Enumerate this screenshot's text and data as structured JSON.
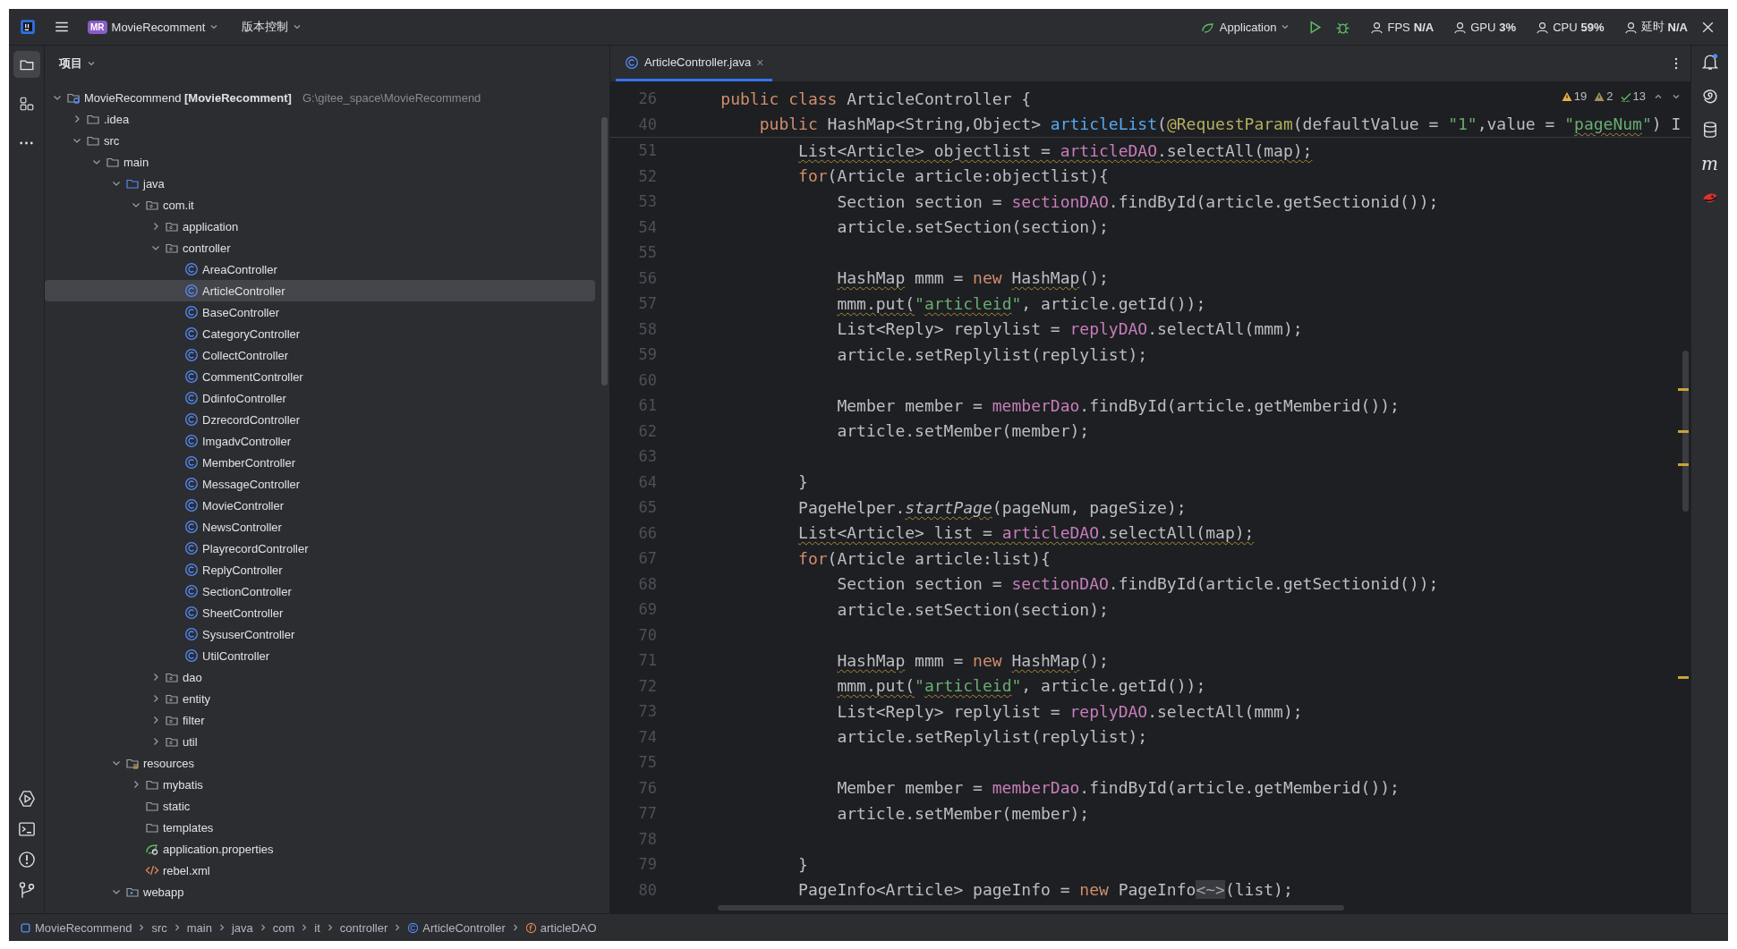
{
  "title_bar": {
    "project_badge": "MR",
    "project": "MovieRecomment",
    "vcs": "版本控制",
    "run_config": "Application",
    "stats": [
      {
        "label": "FPS",
        "value": "N/A"
      },
      {
        "label": "GPU",
        "value": "3%"
      },
      {
        "label": "CPU",
        "value": "59%"
      },
      {
        "label": "延时",
        "value": "N/A"
      }
    ]
  },
  "left_tools": [
    {
      "kind": "project",
      "selected": true
    },
    {
      "kind": "structure",
      "selected": false
    },
    {
      "kind": "more",
      "selected": false
    }
  ],
  "left_tools_bottom": [
    {
      "kind": "run"
    },
    {
      "kind": "terminal"
    },
    {
      "kind": "problems"
    },
    {
      "kind": "git"
    }
  ],
  "project_panel": {
    "title": "项目",
    "tree": [
      {
        "kind": "module",
        "name": "MovieRecommend",
        "module": "[MovieRecomment]",
        "path": "G:\\gitee_space\\MovieRecommend",
        "expanded": true,
        "selected": false,
        "children": [
          {
            "kind": "folder",
            "name": ".idea",
            "expanded": false,
            "selected": false
          },
          {
            "kind": "folder",
            "name": "src",
            "expanded": true,
            "selected": false,
            "children": [
              {
                "kind": "folder",
                "name": "main",
                "expanded": true,
                "selected": false,
                "children": [
                  {
                    "kind": "source",
                    "name": "java",
                    "expanded": true,
                    "selected": false,
                    "children": [
                      {
                        "kind": "package",
                        "name": "com.it",
                        "expanded": true,
                        "selected": false,
                        "children": [
                          {
                            "kind": "package",
                            "name": "application",
                            "expanded": false,
                            "selected": false
                          },
                          {
                            "kind": "package",
                            "name": "controller",
                            "expanded": true,
                            "selected": false,
                            "children": [
                              {
                                "kind": "class",
                                "name": "AreaController",
                                "selected": false
                              },
                              {
                                "kind": "class",
                                "name": "ArticleController",
                                "selected": true
                              },
                              {
                                "kind": "class",
                                "name": "BaseController",
                                "selected": false
                              },
                              {
                                "kind": "class",
                                "name": "CategoryController",
                                "selected": false
                              },
                              {
                                "kind": "class",
                                "name": "CollectController",
                                "selected": false
                              },
                              {
                                "kind": "class",
                                "name": "CommentController",
                                "selected": false
                              },
                              {
                                "kind": "class",
                                "name": "DdinfoController",
                                "selected": false
                              },
                              {
                                "kind": "class",
                                "name": "DzrecordController",
                                "selected": false
                              },
                              {
                                "kind": "class",
                                "name": "ImgadvController",
                                "selected": false
                              },
                              {
                                "kind": "class",
                                "name": "MemberController",
                                "selected": false
                              },
                              {
                                "kind": "class",
                                "name": "MessageController",
                                "selected": false
                              },
                              {
                                "kind": "class",
                                "name": "MovieController",
                                "selected": false
                              },
                              {
                                "kind": "class",
                                "name": "NewsController",
                                "selected": false
                              },
                              {
                                "kind": "class",
                                "name": "PlayrecordController",
                                "selected": false
                              },
                              {
                                "kind": "class",
                                "name": "ReplyController",
                                "selected": false
                              },
                              {
                                "kind": "class",
                                "name": "SectionController",
                                "selected": false
                              },
                              {
                                "kind": "class",
                                "name": "SheetController",
                                "selected": false
                              },
                              {
                                "kind": "class",
                                "name": "SysuserController",
                                "selected": false
                              },
                              {
                                "kind": "class",
                                "name": "UtilController",
                                "selected": false
                              }
                            ]
                          },
                          {
                            "kind": "package",
                            "name": "dao",
                            "expanded": false,
                            "selected": false
                          },
                          {
                            "kind": "package",
                            "name": "entity",
                            "expanded": false,
                            "selected": false
                          },
                          {
                            "kind": "package",
                            "name": "filter",
                            "expanded": false,
                            "selected": false
                          },
                          {
                            "kind": "package",
                            "name": "util",
                            "expanded": false,
                            "selected": false
                          }
                        ]
                      }
                    ]
                  },
                  {
                    "kind": "resources",
                    "name": "resources",
                    "expanded": true,
                    "selected": false,
                    "children": [
                      {
                        "kind": "folder",
                        "name": "mybatis",
                        "expanded": false,
                        "selected": false
                      },
                      {
                        "kind": "folder",
                        "name": "static",
                        "selected": false
                      },
                      {
                        "kind": "folder",
                        "name": "templates",
                        "selected": false
                      },
                      {
                        "kind": "properties",
                        "name": "application.properties",
                        "selected": false
                      },
                      {
                        "kind": "xml",
                        "name": "rebel.xml",
                        "selected": false
                      }
                    ]
                  },
                  {
                    "kind": "web",
                    "name": "webapp",
                    "expanded": true,
                    "selected": false
                  }
                ]
              }
            ]
          }
        ]
      }
    ]
  },
  "editor": {
    "tabs": [
      {
        "label": "ArticleController.java",
        "close": "×",
        "selected": true
      }
    ],
    "inspections": [
      {
        "kind": "warning",
        "count": "19"
      },
      {
        "kind": "weak-warning",
        "count": "2"
      },
      {
        "kind": "typo",
        "count": "13"
      }
    ],
    "sticky_lines": [
      {
        "number": "26",
        "tokens": [
          {
            "text": "    public class",
            "kind": "keyword"
          },
          {
            "text": " ArticleController {"
          }
        ]
      },
      {
        "number": "40",
        "tokens": [
          {
            "text": "        public",
            "kind": "keyword"
          },
          {
            "text": " HashMap<String,Object> "
          },
          {
            "text": "articleList",
            "kind": "method"
          },
          {
            "text": "("
          },
          {
            "text": "@RequestParam",
            "kind": "annotation"
          },
          {
            "text": "(defaultValue = "
          },
          {
            "text": "\"1\"",
            "kind": "string"
          },
          {
            "text": ",value = "
          },
          {
            "text": "\"",
            "kind": "string"
          },
          {
            "text": "pageNum",
            "kind": "string",
            "underline": true
          },
          {
            "text": "\"",
            "kind": "string"
          },
          {
            "text": ") I"
          }
        ]
      }
    ],
    "lines": [
      {
        "number": "51",
        "tokens": [
          {
            "text": "            List<Article> objectlist = ",
            "underline": true
          },
          {
            "text": "articleDAO",
            "kind": "field",
            "underline": true
          },
          {
            "text": ".selectAll(map);",
            "underline": true
          }
        ]
      },
      {
        "number": "52",
        "tokens": [
          {
            "text": "            for",
            "kind": "keyword"
          },
          {
            "text": "(Article article:objectlist){"
          }
        ]
      },
      {
        "number": "53",
        "tokens": [
          {
            "text": "                Section section = "
          },
          {
            "text": "sectionDAO",
            "kind": "field"
          },
          {
            "text": ".findById(article.getSectionid());"
          }
        ]
      },
      {
        "number": "54",
        "tokens": [
          {
            "text": "                article.setSection(section);"
          }
        ]
      },
      {
        "number": "55"
      },
      {
        "number": "56",
        "tokens": [
          {
            "text": "                HashMap",
            "underline": true
          },
          {
            "text": " mmm = "
          },
          {
            "text": "new ",
            "kind": "keyword"
          },
          {
            "text": "HashMap",
            "underline": true
          },
          {
            "text": "();"
          }
        ]
      },
      {
        "number": "57",
        "tokens": [
          {
            "text": "                mmm.put(",
            "underline": true
          },
          {
            "text": "\"",
            "kind": "string"
          },
          {
            "text": "articleid",
            "kind": "string",
            "underline": true
          },
          {
            "text": "\"",
            "kind": "string"
          },
          {
            "text": ", article.getId());"
          }
        ]
      },
      {
        "number": "58",
        "tokens": [
          {
            "text": "                List<Reply> replylist = "
          },
          {
            "text": "replyDAO",
            "kind": "field"
          },
          {
            "text": ".selectAll(mmm);"
          }
        ]
      },
      {
        "number": "59",
        "tokens": [
          {
            "text": "                article.setReplylist(replylist);"
          }
        ]
      },
      {
        "number": "60"
      },
      {
        "number": "61",
        "tokens": [
          {
            "text": "                Member member = "
          },
          {
            "text": "memberDao",
            "kind": "field"
          },
          {
            "text": ".findById(article.getMemberid());"
          }
        ]
      },
      {
        "number": "62",
        "tokens": [
          {
            "text": "                article.setMember(member);"
          }
        ]
      },
      {
        "number": "63"
      },
      {
        "number": "64",
        "tokens": [
          {
            "text": "            }"
          }
        ]
      },
      {
        "number": "65",
        "tokens": [
          {
            "text": "            PageHelper."
          },
          {
            "text": "startPage",
            "kind": "static",
            "underline": true
          },
          {
            "text": "(pageNum, pageSize);"
          }
        ]
      },
      {
        "number": "66",
        "tokens": [
          {
            "text": "            List<Article> list = ",
            "underline": true
          },
          {
            "text": "articleDAO",
            "kind": "field",
            "underline": true
          },
          {
            "text": ".selectAll(map);",
            "underline": true
          }
        ]
      },
      {
        "number": "67",
        "tokens": [
          {
            "text": "            for",
            "kind": "keyword"
          },
          {
            "text": "(Article article:list){"
          }
        ]
      },
      {
        "number": "68",
        "tokens": [
          {
            "text": "                Section section = "
          },
          {
            "text": "sectionDAO",
            "kind": "field"
          },
          {
            "text": ".findById(article.getSectionid());"
          }
        ]
      },
      {
        "number": "69",
        "tokens": [
          {
            "text": "                article.setSection(section);"
          }
        ]
      },
      {
        "number": "70"
      },
      {
        "number": "71",
        "tokens": [
          {
            "text": "                HashMap",
            "underline": true
          },
          {
            "text": " mmm = "
          },
          {
            "text": "new ",
            "kind": "keyword"
          },
          {
            "text": "HashMap",
            "underline": true
          },
          {
            "text": "();"
          }
        ]
      },
      {
        "number": "72",
        "tokens": [
          {
            "text": "                mmm.put(",
            "underline": true
          },
          {
            "text": "\"",
            "kind": "string"
          },
          {
            "text": "articleid",
            "kind": "string",
            "underline": true
          },
          {
            "text": "\"",
            "kind": "string"
          },
          {
            "text": ", article.getId());"
          }
        ]
      },
      {
        "number": "73",
        "tokens": [
          {
            "text": "                List<Reply> replylist = "
          },
          {
            "text": "replyDAO",
            "kind": "field"
          },
          {
            "text": ".selectAll(mmm);"
          }
        ]
      },
      {
        "number": "74",
        "tokens": [
          {
            "text": "                article.setReplylist(replylist);"
          }
        ]
      },
      {
        "number": "75"
      },
      {
        "number": "76",
        "tokens": [
          {
            "text": "                Member member = "
          },
          {
            "text": "memberDao",
            "kind": "field"
          },
          {
            "text": ".findById(article.getMemberid());"
          }
        ]
      },
      {
        "number": "77",
        "tokens": [
          {
            "text": "                article.setMember(member);"
          }
        ]
      },
      {
        "number": "78"
      },
      {
        "number": "79",
        "tokens": [
          {
            "text": "            }"
          }
        ]
      },
      {
        "number": "80",
        "tokens": [
          {
            "text": "            PageInfo<Article> pageInfo = "
          },
          {
            "text": "new",
            "kind": "keyword"
          },
          {
            "text": " PageInfo"
          },
          {
            "text": "<~>",
            "kind": "folded"
          },
          {
            "text": "(list);"
          }
        ]
      }
    ]
  },
  "right_tools": [
    {
      "kind": "notifications"
    },
    {
      "kind": "ai"
    },
    {
      "kind": "database"
    },
    {
      "kind": "maven",
      "glyph": "m"
    },
    {
      "kind": "plugin"
    }
  ],
  "breadcrumbs": [
    {
      "kind": "module",
      "label": "MovieRecommend"
    },
    {
      "kind": "folder",
      "label": "src"
    },
    {
      "kind": "folder",
      "label": "main"
    },
    {
      "kind": "folder",
      "label": "java"
    },
    {
      "kind": "folder",
      "label": "com"
    },
    {
      "kind": "folder",
      "label": "it"
    },
    {
      "kind": "folder",
      "label": "controller"
    },
    {
      "kind": "class",
      "label": "ArticleController"
    },
    {
      "kind": "field",
      "label": "articleDAO"
    }
  ]
}
